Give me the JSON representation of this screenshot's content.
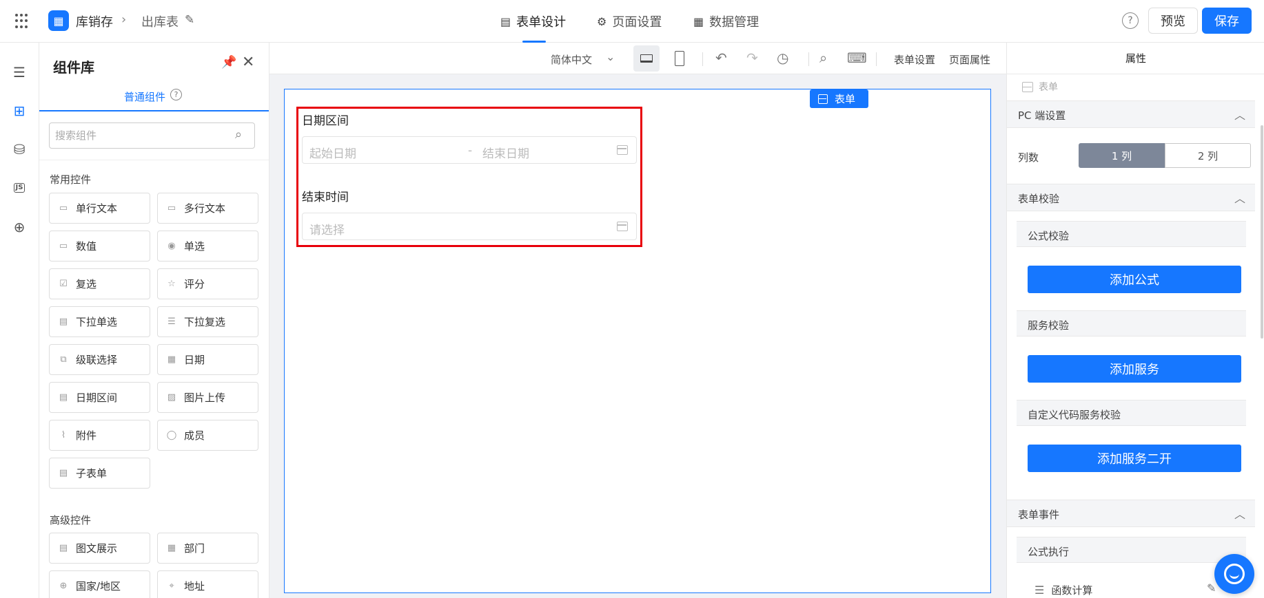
{
  "topbar": {
    "app_name": "库销存",
    "page_name": "出库表",
    "tabs": [
      {
        "label": "表单设计",
        "icon": "document-icon"
      },
      {
        "label": "页面设置",
        "icon": "gear-icon"
      },
      {
        "label": "数据管理",
        "icon": "table-icon"
      }
    ],
    "help_glyph": "?",
    "preview_label": "预览",
    "save_label": "保存"
  },
  "rail": {
    "items": [
      "outline-icon",
      "components-icon",
      "datasource-icon",
      "js-icon",
      "globe-icon"
    ],
    "js_label": "JS"
  },
  "panel": {
    "title": "组件库",
    "tab_label": "普通组件",
    "search_placeholder": "搜索组件",
    "common_label": "常用控件",
    "common_items": [
      "单行文本",
      "多行文本",
      "数值",
      "单选",
      "复选",
      "评分",
      "下拉单选",
      "下拉复选",
      "级联选择",
      "日期",
      "日期区间",
      "图片上传",
      "附件",
      "成员",
      "子表单"
    ],
    "advanced_label": "高级控件",
    "advanced_items": [
      "图文展示",
      "部门",
      "国家/地区",
      "地址"
    ]
  },
  "toolbar": {
    "language": "简体中文",
    "form_settings": "表单设置",
    "page_props": "页面属性"
  },
  "canvas": {
    "badge": "表单",
    "fields": [
      {
        "label": "日期区间",
        "start_placeholder": "起始日期",
        "separator": "-",
        "end_placeholder": "结束日期"
      },
      {
        "label": "结束时间",
        "placeholder": "请选择"
      }
    ]
  },
  "props": {
    "header": "属性",
    "selected": "表单",
    "pc_section": "PC 端设置",
    "cols_label": "列数",
    "col_options": [
      "1 列",
      "2 列"
    ],
    "selected_col": "1 列",
    "validation_section": "表单校验",
    "formula_validation": "公式校验",
    "add_formula": "添加公式",
    "service_validation": "服务校验",
    "add_service": "添加服务",
    "custom_validation": "自定义代码服务校验",
    "add_service2": "添加服务二开",
    "events_section": "表单事件",
    "formula_exec": "公式执行",
    "func_calc": "函数计算"
  }
}
